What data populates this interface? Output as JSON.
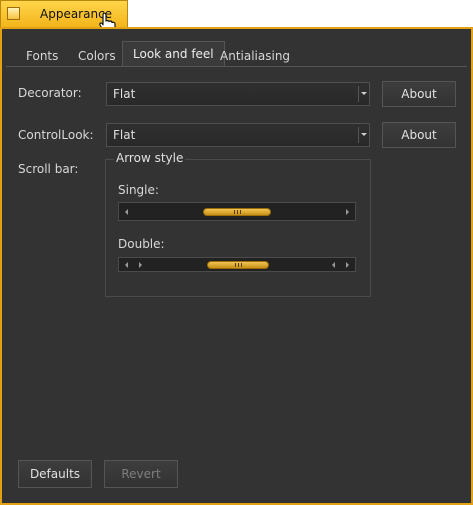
{
  "window": {
    "title": "Appearance",
    "accent_color": "#e3a214"
  },
  "tabs": [
    {
      "label": "Fonts",
      "active": false
    },
    {
      "label": "Colors",
      "active": false
    },
    {
      "label": "Look and feel",
      "active": true
    },
    {
      "label": "Antialiasing",
      "active": false
    }
  ],
  "decorator": {
    "label": "Decorator:",
    "selected": "Flat",
    "about_label": "About"
  },
  "control_look": {
    "label": "ControlLook:",
    "selected": "Flat",
    "about_label": "About"
  },
  "scroll_bar": {
    "label": "Scroll bar:",
    "group_title": "Arrow style",
    "single": {
      "label": "Single:"
    },
    "double": {
      "label": "Double:"
    }
  },
  "footer": {
    "defaults_label": "Defaults",
    "revert_label": "Revert",
    "revert_enabled": false
  }
}
